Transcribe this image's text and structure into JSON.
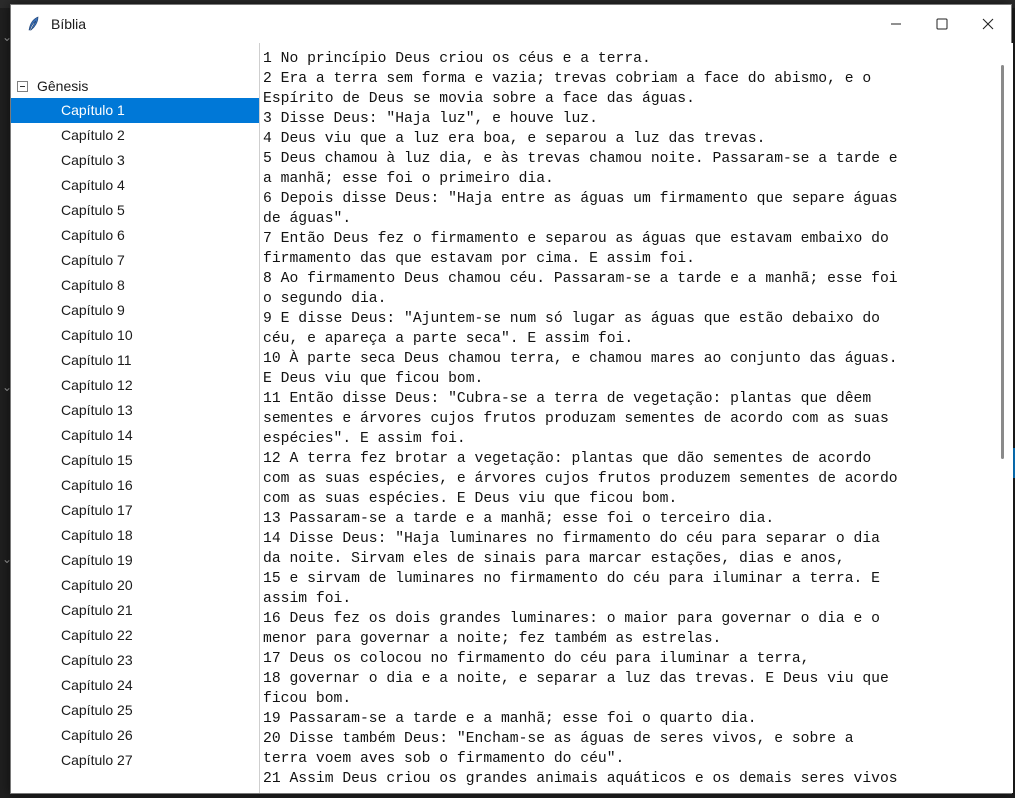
{
  "window": {
    "title": "Bíblia"
  },
  "tree": {
    "book": "Gênesis",
    "selected_index": 0,
    "chapters": [
      "Capítulo 1",
      "Capítulo 2",
      "Capítulo 3",
      "Capítulo 4",
      "Capítulo 5",
      "Capítulo 6",
      "Capítulo 7",
      "Capítulo 8",
      "Capítulo 9",
      "Capítulo 10",
      "Capítulo 11",
      "Capítulo 12",
      "Capítulo 13",
      "Capítulo 14",
      "Capítulo 15",
      "Capítulo 16",
      "Capítulo 17",
      "Capítulo 18",
      "Capítulo 19",
      "Capítulo 20",
      "Capítulo 21",
      "Capítulo 22",
      "Capítulo 23",
      "Capítulo 24",
      "Capítulo 25",
      "Capítulo 26",
      "Capítulo 27"
    ]
  },
  "text_lines": [
    "1 No princípio Deus criou os céus e a terra.",
    "2 Era a terra sem forma e vazia; trevas cobriam a face do abismo, e o",
    "Espírito de Deus se movia sobre a face das águas.",
    "3 Disse Deus: \"Haja luz\", e houve luz.",
    "4 Deus viu que a luz era boa, e separou a luz das trevas.",
    "5 Deus chamou à luz dia, e às trevas chamou noite. Passaram-se a tarde e",
    "a manhã; esse foi o primeiro dia.",
    "6 Depois disse Deus: \"Haja entre as águas um firmamento que separe águas",
    "de águas\".",
    "7 Então Deus fez o firmamento e separou as águas que estavam embaixo do",
    "firmamento das que estavam por cima. E assim foi.",
    "8 Ao firmamento Deus chamou céu. Passaram-se a tarde e a manhã; esse foi",
    "o segundo dia.",
    "9 E disse Deus: \"Ajuntem-se num só lugar as águas que estão debaixo do",
    "céu, e apareça a parte seca\". E assim foi.",
    "10 À parte seca Deus chamou terra, e chamou mares ao conjunto das águas.",
    "E Deus viu que ficou bom.",
    "11 Então disse Deus: \"Cubra-se a terra de vegetação: plantas que dêem",
    "sementes e árvores cujos frutos produzam sementes de acordo com as suas",
    "espécies\". E assim foi.",
    "12 A terra fez brotar a vegetação: plantas que dão sementes de acordo",
    "com as suas espécies, e árvores cujos frutos produzem sementes de acordo",
    "com as suas espécies. E Deus viu que ficou bom.",
    "13 Passaram-se a tarde e a manhã; esse foi o terceiro dia.",
    "14 Disse Deus: \"Haja luminares no firmamento do céu para separar o dia",
    "da noite. Sirvam eles de sinais para marcar estações, dias e anos,",
    "15 e sirvam de luminares no firmamento do céu para iluminar a terra. E",
    "assim foi.",
    "16 Deus fez os dois grandes luminares: o maior para governar o dia e o",
    "menor para governar a noite; fez também as estrelas.",
    "17 Deus os colocou no firmamento do céu para iluminar a terra,",
    "18 governar o dia e a noite, e separar a luz das trevas. E Deus viu que",
    "ficou bom.",
    "19 Passaram-se a tarde e a manhã; esse foi o quarto dia.",
    "20 Disse também Deus: \"Encham-se as águas de seres vivos, e sobre a",
    "terra voem aves sob o firmamento do céu\".",
    "21 Assim Deus criou os grandes animais aquáticos e os demais seres vivos"
  ],
  "colors": {
    "selection": "#0078d7",
    "text": "#111111"
  },
  "icons": {
    "app": "feather-icon",
    "minimize": "minimize-icon",
    "maximize": "maximize-icon",
    "close": "close-icon",
    "collapse": "collapse-icon"
  }
}
